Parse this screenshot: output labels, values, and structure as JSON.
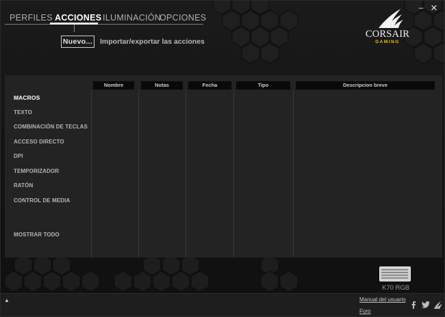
{
  "tabs": [
    {
      "label": "PERFILES",
      "active": false
    },
    {
      "label": "ACCIONES",
      "active": true
    },
    {
      "label": "ILUMINACIÓN",
      "active": false
    },
    {
      "label": "OPCIONES",
      "active": false
    }
  ],
  "toolbar": {
    "new_label": "Nuevo...",
    "import_label": "Importar/exportar las acciones"
  },
  "window": {
    "minimize_symbol": "–",
    "close_symbol": "✕"
  },
  "logo": {
    "word": "CORSAIR",
    "sub": "GAMING",
    "sub_color": "#f3c300"
  },
  "categories": [
    {
      "label": "MACROS",
      "active": true
    },
    {
      "label": "TEXTO",
      "active": false
    },
    {
      "label": "COMBINACIÓN DE TECLAS",
      "active": false
    },
    {
      "label": "ACCESO DIRECTO",
      "active": false
    },
    {
      "label": "DPI",
      "active": false
    },
    {
      "label": "TEMPORIZADOR",
      "active": false
    },
    {
      "label": "RATÓN",
      "active": false
    },
    {
      "label": "CONTROL DE MEDIA",
      "active": false
    },
    {
      "label": "MOSTRAR TODO",
      "active": false
    }
  ],
  "table": {
    "columns": [
      "Nombre",
      "Notas",
      "Fecha",
      "Tipo",
      "Descripcion breve"
    ],
    "rows": []
  },
  "device": {
    "label": "K70 RGB",
    "icon": "keyboard-icon"
  },
  "footer": {
    "collapse_symbol": "▲",
    "manual_label": "Manual del usuario",
    "forum_label": "Foro",
    "social_icons": [
      "facebook-icon",
      "twitter-icon",
      "corsair-sails-icon"
    ]
  }
}
